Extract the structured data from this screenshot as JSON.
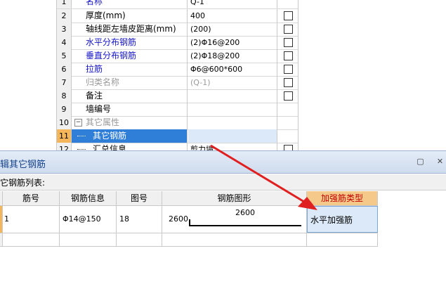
{
  "properties": {
    "rows": [
      {
        "num": "1",
        "name": "名称",
        "value": "Q-1",
        "style": "blue",
        "checkbox": false
      },
      {
        "num": "2",
        "name": "厚度(mm)",
        "value": "400",
        "style": "normal",
        "checkbox": true
      },
      {
        "num": "3",
        "name": "轴线距左墙皮距离(mm)",
        "value": "(200)",
        "style": "normal",
        "checkbox": true
      },
      {
        "num": "4",
        "name": "水平分布钢筋",
        "value": "(2)Φ16@200",
        "style": "blue",
        "checkbox": true
      },
      {
        "num": "5",
        "name": "垂直分布钢筋",
        "value": "(2)Φ18@200",
        "style": "blue",
        "checkbox": true
      },
      {
        "num": "6",
        "name": "拉筋",
        "value": "Φ6@600*600",
        "style": "blue",
        "checkbox": true
      },
      {
        "num": "7",
        "name": "归类名称",
        "value": "(Q-1)",
        "style": "gray",
        "checkbox": true
      },
      {
        "num": "8",
        "name": "备注",
        "value": "",
        "style": "normal",
        "checkbox": true
      },
      {
        "num": "9",
        "name": "墙编号",
        "value": "",
        "style": "normal",
        "checkbox": false
      },
      {
        "num": "10",
        "name": "其它属性",
        "value": "",
        "style": "group",
        "checkbox": false
      },
      {
        "num": "11",
        "name": "其它钢筋",
        "value": "",
        "style": "selected",
        "checkbox": false
      },
      {
        "num": "12",
        "name": "汇总信息",
        "value": "剪力墙",
        "style": "child",
        "checkbox": true
      }
    ]
  },
  "panel": {
    "title": "编辑其它钢筋",
    "list_label": "其它钢筋列表:",
    "columns": [
      "筋号",
      "钢筋信息",
      "图号",
      "钢筋图形",
      "加强筋类型"
    ],
    "rows": [
      {
        "index": "1",
        "bar_no": "",
        "info": "Φ14@150",
        "figure_no": "18",
        "shape_left": "2600",
        "shape_mid": "2600",
        "type": "水平加强筋"
      }
    ]
  },
  "colors": {
    "accent_blue": "#1414c8",
    "selection": "#2f7fd9",
    "header_highlight": "#f5c98a",
    "arrow": "#e02020"
  }
}
